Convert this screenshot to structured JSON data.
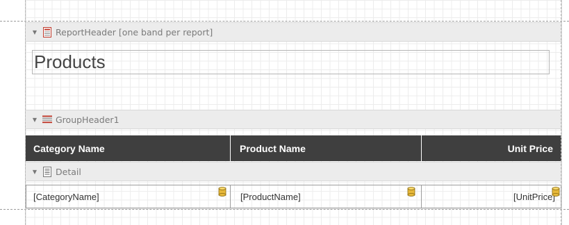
{
  "report_header_band": {
    "label": "ReportHeader [one band per report]",
    "collapse_glyph": "▼",
    "icon": "report-header-band-icon"
  },
  "title_label": {
    "text": "Products"
  },
  "group_header_band": {
    "label": "GroupHeader1",
    "collapse_glyph": "▼",
    "icon": "group-header-band-icon"
  },
  "table_header": {
    "cells": [
      "Category Name",
      "Product Name",
      "Unit Price"
    ]
  },
  "detail_band": {
    "label": "Detail",
    "collapse_glyph": "▼",
    "icon": "detail-band-icon"
  },
  "detail_row": {
    "cells": [
      "[CategoryName]",
      "[ProductName]",
      "[UnitPrice]"
    ],
    "binding_icon": "database-icon"
  },
  "colors": {
    "table_header_bg": "#3f3f3f",
    "band_strip_bg": "#ececec",
    "band_icon_red": "#c0392b",
    "db_icon_gold": "#e6b83a"
  }
}
